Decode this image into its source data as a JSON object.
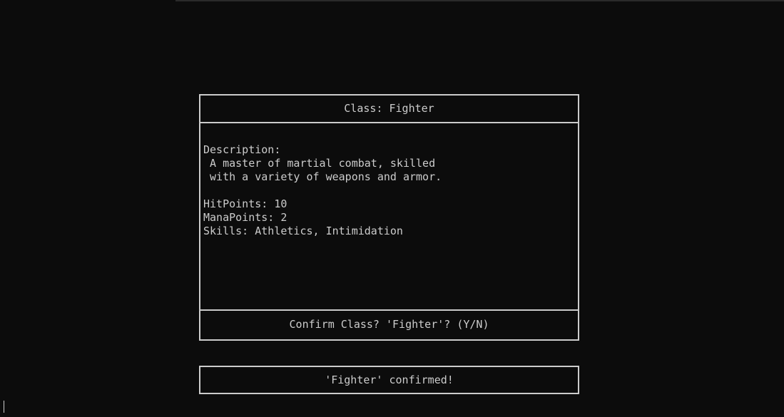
{
  "class_panel": {
    "title": "Class: Fighter",
    "description_label": "Description:",
    "description_lines": [
      " A master of martial combat, skilled",
      " with a variety of weapons and armor."
    ],
    "hit_points": "HitPoints: 10",
    "mana_points": "ManaPoints: 2",
    "skills": "Skills: Athletics, Intimidation",
    "prompt": "Confirm Class? 'Fighter'? (Y/N)"
  },
  "confirmation": {
    "message": "'Fighter' confirmed!"
  },
  "colors": {
    "background": "#0c0c0c",
    "foreground": "#cccccc"
  }
}
